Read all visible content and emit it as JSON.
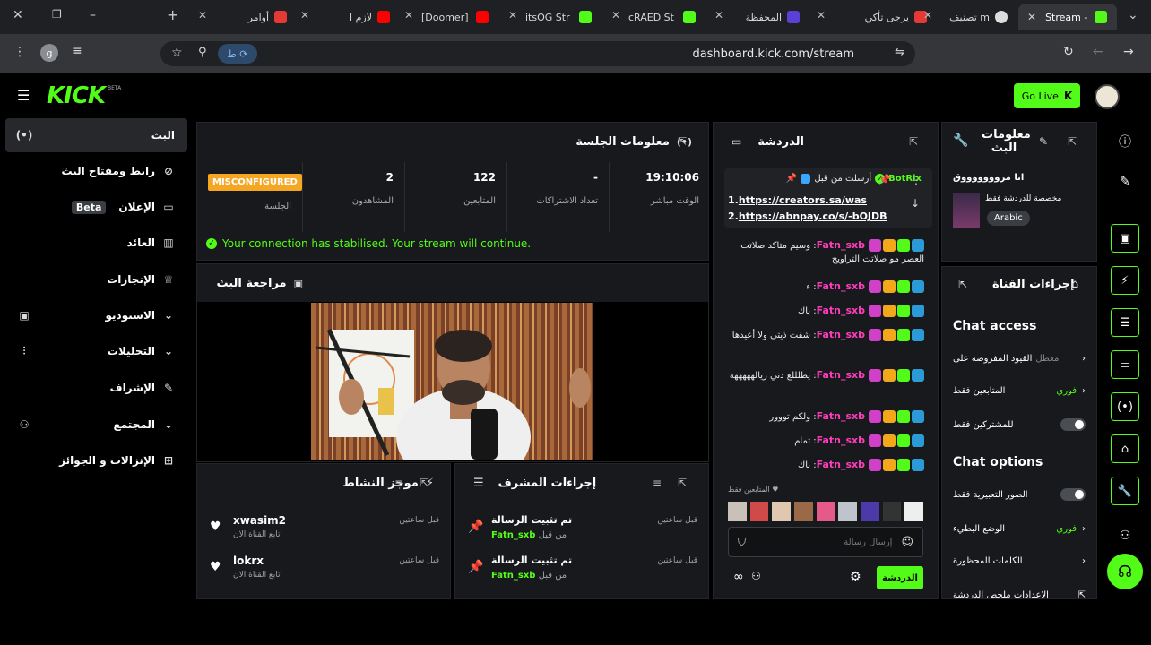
{
  "browser": {
    "tabs": [
      {
        "title": "أوامر"
      },
      {
        "title": "لازم ا"
      },
      {
        "title": "[Doomer]"
      },
      {
        "title": "itsOG Str"
      },
      {
        "title": "cRAED St"
      },
      {
        "title": "المحفظة"
      },
      {
        "title": "يرجى تأكي"
      },
      {
        "title": "تصنيف m"
      },
      {
        "title": "Stream -"
      }
    ],
    "url": "dashboard.kick.com/stream",
    "profile_initial": "g"
  },
  "header": {
    "logo": "KICK",
    "logo_beta": "BETA",
    "go_live": "Go Live"
  },
  "sidebar": {
    "items": [
      {
        "label": "البث"
      },
      {
        "label": "رابط ومفتاح البث"
      },
      {
        "label": "الإعلان",
        "badge": "Beta"
      },
      {
        "label": "العائد"
      },
      {
        "label": "الإنجازات"
      },
      {
        "label": "الاستوديو"
      },
      {
        "label": "التحليلات"
      },
      {
        "label": "الإشراف"
      },
      {
        "label": "المجتمع"
      },
      {
        "label": "الإنزالات و الجوائز"
      }
    ]
  },
  "session": {
    "title": "معلومات الجلسة",
    "stats": [
      {
        "value": "19:10:06",
        "label": "الوقت مباشر"
      },
      {
        "value": "-",
        "label": "تعداد الاشتراكات"
      },
      {
        "value": "122",
        "label": "المتابعين"
      },
      {
        "value": "2",
        "label": "المشاهدون"
      },
      {
        "value": "MISCONFIGURED",
        "label": "الجلسة"
      }
    ],
    "connection": "Your connection has stabilised. Your stream will continue."
  },
  "preview": {
    "title": "مراجعة البث"
  },
  "activity": {
    "title": "موجز النشاط",
    "items": [
      {
        "name": "xwasim2",
        "sub": "تابع القناة الان",
        "time": "قبل ساعتين"
      },
      {
        "name": "lokrx",
        "sub": "تابع القناة الان",
        "time": "قبل ساعتين"
      }
    ]
  },
  "modactions": {
    "title": "إجراءات المشرف",
    "items": [
      {
        "title": "تم تثبيت الرسالة",
        "by": "من قبل",
        "user": "Fatn_sxb",
        "time": "قبل ساعتين"
      },
      {
        "title": "تم تثبيت الرسالة",
        "by": "من قبل",
        "user": "Fatn_sxb",
        "time": "قبل ساعتين"
      }
    ]
  },
  "chat": {
    "title": "الدردشة",
    "pinned": {
      "author": "BotRix",
      "prefix": "أرسلت من قبل",
      "line1_num": "1.",
      "line1": "https://creators.sa/was",
      "line2_num": "2.",
      "line2": "https://abnpay.co/s/-bOJDB"
    },
    "messages": [
      {
        "user": "Fatn_sxb",
        "text": "وسيم متاكد صلاتت العصر مو صلاتت التراويح"
      },
      {
        "user": "Fatn_sxb",
        "text": "ء"
      },
      {
        "user": "Fatn_sxb",
        "text": "باك"
      },
      {
        "user": "Fatn_sxb",
        "text": "شفت ذيتي ولا أعيدها"
      },
      {
        "user": "Fatn_sxb",
        "text": "يطلللع دني ريالهههههه"
      },
      {
        "user": "Fatn_sxb",
        "text": "ولكم تووور"
      },
      {
        "user": "Fatn_sxb",
        "text": "تمام"
      },
      {
        "user": "Fatn_sxb",
        "text": "باك"
      }
    ],
    "followers_only": "المتابعين فقط",
    "input_placeholder": "إرسال رسالة",
    "send": "الدردشة"
  },
  "streaminfo": {
    "title": "معلومات البث",
    "stream_title": "انا مروووووووق",
    "category": "مخصصة للدردشة فقط",
    "language": "Arabic"
  },
  "channel": {
    "title": "إجراءات القناة",
    "chat_access": "Chat access",
    "access_rows": [
      {
        "label": "القيود المفروضة على",
        "value": "معطل"
      },
      {
        "label": "المتابعين فقط",
        "value": "فوري"
      },
      {
        "label": "للمشتركين فقط",
        "value": ""
      }
    ],
    "chat_options": "Chat options",
    "option_rows": [
      {
        "label": "الصور التعبيرية فقط",
        "value": ""
      },
      {
        "label": "الوضع البطيء",
        "value": "فوري"
      },
      {
        "label": "الكلمات المحظورة",
        "value": ""
      },
      {
        "label": "الإعدادات ملخص الدردشة",
        "value": ""
      }
    ]
  },
  "colors": {
    "accent": "#53fc18",
    "bg": "#000000",
    "panel": "#18191c",
    "chat_user": "#ff3dbc",
    "warning": "#f5a623"
  }
}
